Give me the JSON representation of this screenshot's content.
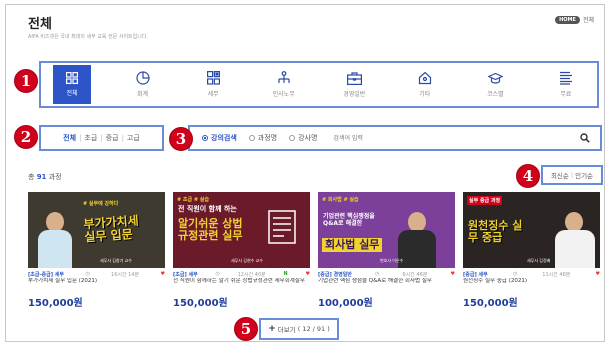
{
  "header": {
    "title": "전체",
    "subtitle": "AIFA 비즈넷은 국내 최대의 세무 교육 전문 사이트입니다.",
    "home_tag": "HOME",
    "breadcrumb": "전체"
  },
  "badges": [
    "1",
    "2",
    "3",
    "4",
    "5"
  ],
  "categories": [
    {
      "label": "전체",
      "icon": "grid-icon",
      "active": true
    },
    {
      "label": "회계",
      "icon": "pie-chart-icon"
    },
    {
      "label": "세무",
      "icon": "calculator-icon"
    },
    {
      "label": "인사노무",
      "icon": "org-chart-icon"
    },
    {
      "label": "경영일반",
      "icon": "briefcase-icon"
    },
    {
      "label": "기타",
      "icon": "house-icon"
    },
    {
      "label": "코스별",
      "icon": "graduation-cap-icon"
    },
    {
      "label": "무료",
      "icon": "book-stack-icon"
    }
  ],
  "levels": {
    "items": [
      "전체",
      "초급",
      "중급",
      "고급"
    ],
    "selected": "전체"
  },
  "search": {
    "options": [
      "강의검색",
      "과정명",
      "강사명"
    ],
    "selected": "강의검색",
    "placeholder": "검색어 입력"
  },
  "count": {
    "prefix": "총",
    "value": "91",
    "suffix": "과정"
  },
  "sort": {
    "options": [
      "최신순",
      "인기순"
    ]
  },
  "courses": [
    {
      "thumb_tag": "# 실무에 강하다",
      "thumb_title": "부가가치세 실무 입문",
      "thumb_author": "세무사 김창기 교수",
      "level": "[초급-중급] 세무",
      "duration": "16시간 14분",
      "title": "부가가치세 실무 입문 (2021)",
      "price": "150,000원",
      "colors": {
        "bg": "#3e3a30",
        "accent": "#f2d233",
        "shirt": "#cfe6f2"
      }
    },
    {
      "thumb_tag": "# 초급 # 실습",
      "thumb_title": "알기쉬운 상법규정관련 실무",
      "thumb_lead": "전 직원이 함께 하는",
      "thumb_author": "세무사 김현수 교수",
      "level": "[초급] 세무",
      "duration": "12시간 40분",
      "title": "전 직원이 함께하는 알기 쉬운 상법규정관련 세무회계실무",
      "price": "150,000원",
      "colors": {
        "bg": "#6b1a2a",
        "accent": "#f2d233",
        "shirt": "#ffffff"
      }
    },
    {
      "thumb_tag": "# 회사법 # 실습",
      "thumb_title": "회사법 실무",
      "thumb_lead": "기업관련 핵심쟁점을 Q&A로 해결한",
      "thumb_author": "변호사 이은수",
      "level": "[중급] 경영일반",
      "duration": "6시간 46분",
      "title": "기업관련 핵심 쟁점을 Q&A로 해결한 회사법 실무",
      "price": "100,000원",
      "colors": {
        "bg": "#7c3f9a",
        "accent": "#f2d233",
        "shirt": "#ffffff"
      }
    },
    {
      "thumb_tag": "실무 중급 과정",
      "thumb_title": "원천징수 실무 중급",
      "thumb_author": "세무사 김정배",
      "level": "[중급] 세무",
      "duration": "11시간 46분",
      "title": "원천징수 실무 중급 (2021)",
      "price": "150,000원",
      "colors": {
        "bg": "#2a2423",
        "accent": "#f2d233",
        "shirt": "#f2f2f2"
      }
    }
  ],
  "more": {
    "label": "더보기",
    "progress": "( 12 / 91 )"
  },
  "colors": {
    "primary": "#2d55c8",
    "badge": "#d0021b",
    "highlight_border": "#6a8cd8",
    "price": "#1f3e9b"
  }
}
